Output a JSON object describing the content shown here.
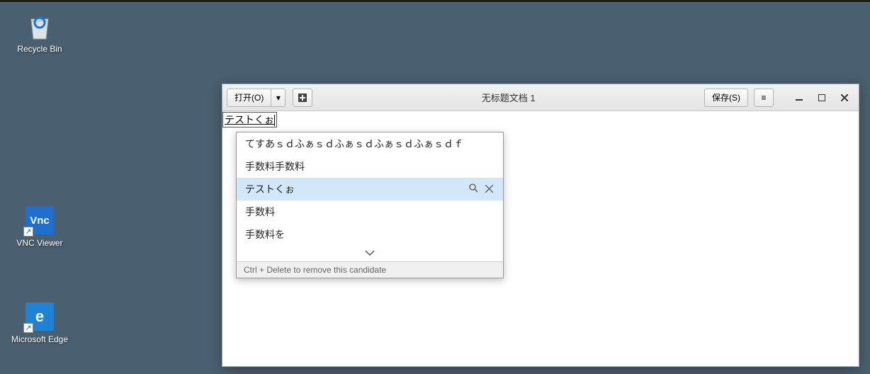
{
  "desktop": {
    "icons": [
      {
        "name": "recycle-bin",
        "label": "Recycle Bin"
      },
      {
        "name": "vnc-viewer",
        "label": "VNC Viewer"
      },
      {
        "name": "microsoft-edge",
        "label": "Microsoft Edge"
      }
    ]
  },
  "window": {
    "open_label": "打开(O)",
    "save_label": "保存(S)",
    "title": "无标题文档 1"
  },
  "editor": {
    "preedit": "テストくぉ"
  },
  "ime": {
    "candidates": [
      "てすあｓｄふぁｓｄふぁｓｄふぁｓｄふぁｓｄｆ",
      "手数料手数料",
      "テストくぉ",
      "手数料",
      "手数料を"
    ],
    "selected_index": 2,
    "footer_hint": "Ctrl + Delete to remove this candidate"
  }
}
